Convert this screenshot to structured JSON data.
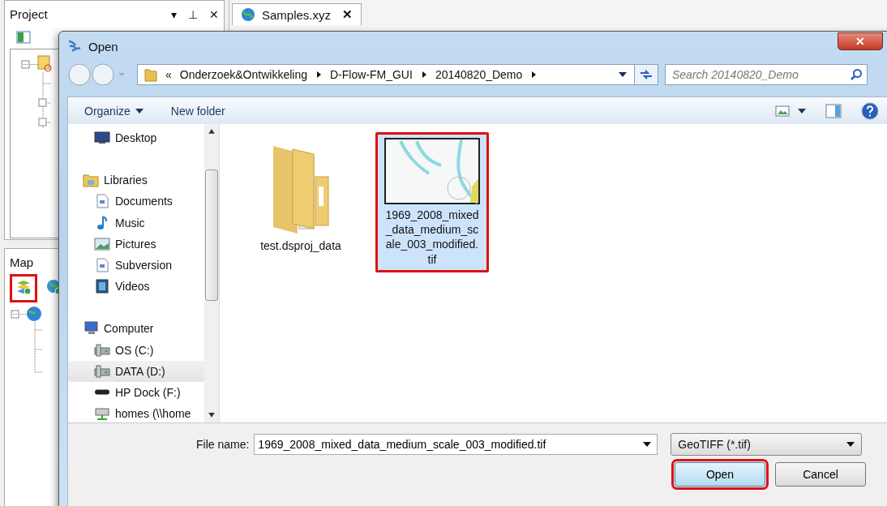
{
  "app": {
    "project_panel": {
      "title": "Project",
      "controls": [
        "▾",
        "⊥",
        "✕"
      ]
    },
    "document_tab": {
      "label": "Samples.xyz",
      "close": "✕",
      "selected": true
    },
    "map_panel": {
      "title": "Map",
      "tools": [
        {
          "kind": "add-layer",
          "annotated": true
        },
        {
          "kind": "add-globe-layer",
          "annotated": false
        }
      ]
    }
  },
  "dialog": {
    "title": "Open",
    "close": "✕",
    "breadcrumb": {
      "overflow": "«",
      "parts": [
        "Onderzoek&Ontwikkeling",
        "D-Flow-FM_GUI",
        "20140820_Demo"
      ]
    },
    "search": {
      "placeholder": "Search 20140820_Demo"
    },
    "toolbar": {
      "organize": "Organize",
      "new_folder": "New folder"
    },
    "nav": [
      {
        "label": "Desktop",
        "kind": "desktop",
        "selected": false
      },
      {
        "label": "Libraries",
        "kind": "library",
        "selected": false,
        "children": [
          {
            "label": "Documents",
            "kind": "document",
            "selected": false
          },
          {
            "label": "Music",
            "kind": "music",
            "selected": false
          },
          {
            "label": "Pictures",
            "kind": "pictures",
            "selected": false
          },
          {
            "label": "Subversion",
            "kind": "document",
            "selected": false
          },
          {
            "label": "Videos",
            "kind": "video",
            "selected": false
          }
        ]
      },
      {
        "label": "Computer",
        "kind": "computer",
        "selected": false,
        "children": [
          {
            "label": "OS (C:)",
            "kind": "drive",
            "selected": false
          },
          {
            "label": "DATA (D:)",
            "kind": "drive",
            "selected": true
          },
          {
            "label": "HP Dock (F:)",
            "kind": "dock",
            "selected": false
          },
          {
            "label": "homes (\\\\home",
            "kind": "network",
            "selected": false
          }
        ]
      }
    ],
    "files": [
      {
        "name": "test.dsproj_data",
        "kind": "folder",
        "selected": false,
        "annotated": false
      },
      {
        "name": "1969_2008_mixed_data_medium_scale_003_modified.tif",
        "kind": "image",
        "selected": true,
        "annotated": true
      }
    ],
    "file_name": {
      "label": "File name:",
      "value": "1969_2008_mixed_data_medium_scale_003_modified.tif"
    },
    "file_type": {
      "value": "GeoTIFF (*.tif)"
    },
    "buttons": [
      {
        "label": "Open",
        "kind": "primary",
        "annotated": true
      },
      {
        "label": "Cancel",
        "kind": "normal",
        "annotated": false
      }
    ]
  }
}
